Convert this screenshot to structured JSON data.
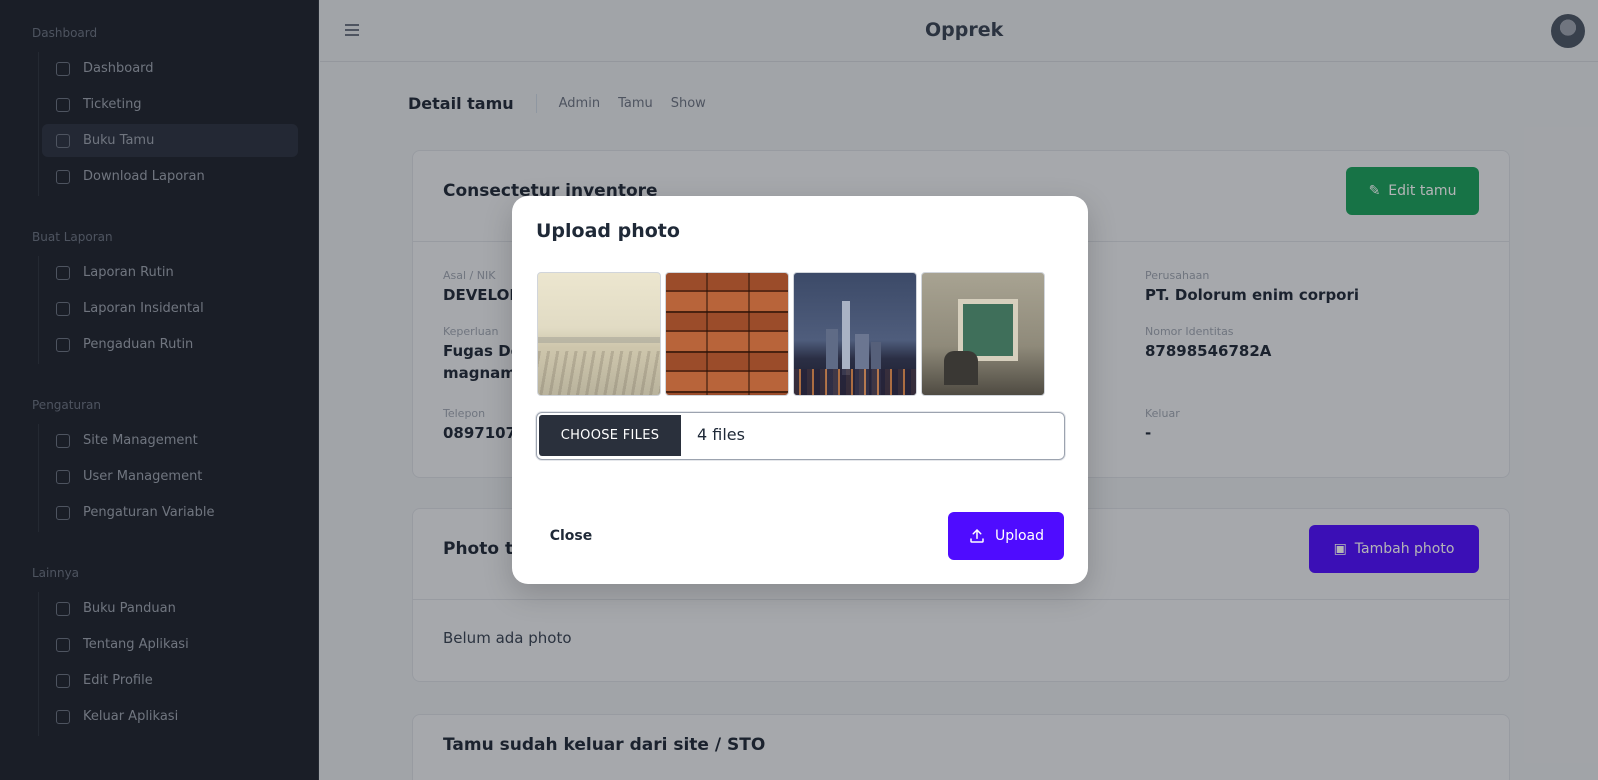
{
  "app": {
    "title": "Opprek"
  },
  "sidebar": {
    "sections": [
      {
        "label": "Dashboard",
        "items": [
          {
            "label": "Dashboard",
            "icon": "grid-icon"
          },
          {
            "label": "Ticketing",
            "icon": "ticket-icon"
          },
          {
            "label": "Buku Tamu",
            "icon": "book-icon",
            "active": true
          },
          {
            "label": "Download Laporan",
            "icon": "download-icon"
          }
        ]
      },
      {
        "label": "Buat Laporan",
        "items": [
          {
            "label": "Laporan Rutin",
            "icon": "file-icon"
          },
          {
            "label": "Laporan Insidental",
            "icon": "file-icon"
          },
          {
            "label": "Pengaduan Rutin",
            "icon": "file-icon"
          }
        ]
      },
      {
        "label": "Pengaturan",
        "items": [
          {
            "label": "Site Management",
            "icon": "site-icon"
          },
          {
            "label": "User Management",
            "icon": "user-icon"
          },
          {
            "label": "Pengaturan Variable",
            "icon": "settings-icon"
          }
        ]
      },
      {
        "label": "Lainnya",
        "items": [
          {
            "label": "Buku Panduan",
            "icon": "book-icon"
          },
          {
            "label": "Tentang Aplikasi",
            "icon": "info-icon"
          },
          {
            "label": "Edit Profile",
            "icon": "user-icon"
          },
          {
            "label": "Keluar Aplikasi",
            "icon": "logout-icon"
          }
        ]
      }
    ]
  },
  "page": {
    "title": "Detail tamu",
    "breadcrumb": [
      "Admin",
      "Tamu",
      "Show"
    ]
  },
  "detail_card": {
    "heading": "Consectetur inventore",
    "edit_label": "Edit tamu",
    "left_fields": [
      {
        "label": "Asal / NIK",
        "value": "DEVELOPER"
      },
      {
        "label": "Keperluan",
        "value": "Fugas Dolor"
      },
      {
        "label": "",
        "value": "magnam"
      },
      {
        "label": "Telepon",
        "value": "0897107"
      }
    ],
    "right_fields": [
      {
        "label": "Perusahaan",
        "value": "PT. Dolorum enim corpori"
      },
      {
        "label": "Nomor Identitas",
        "value": "87898546782A"
      },
      {
        "label": "Keluar",
        "value": "-"
      }
    ]
  },
  "photo_card": {
    "heading": "Photo t",
    "add_label": "Tambah photo",
    "empty_text": "Belum ada photo"
  },
  "exit_card": {
    "heading": "Tamu sudah keluar dari site / STO"
  },
  "modal": {
    "title": "Upload photo",
    "thumbnails": [
      "beach-photo",
      "wood-planks-photo",
      "city-night-photo",
      "old-building-photo"
    ],
    "choose_label": "CHOOSE FILES",
    "file_count": "4 files",
    "close_label": "Close",
    "upload_label": "Upload",
    "accent_color": "#4f0cff"
  }
}
